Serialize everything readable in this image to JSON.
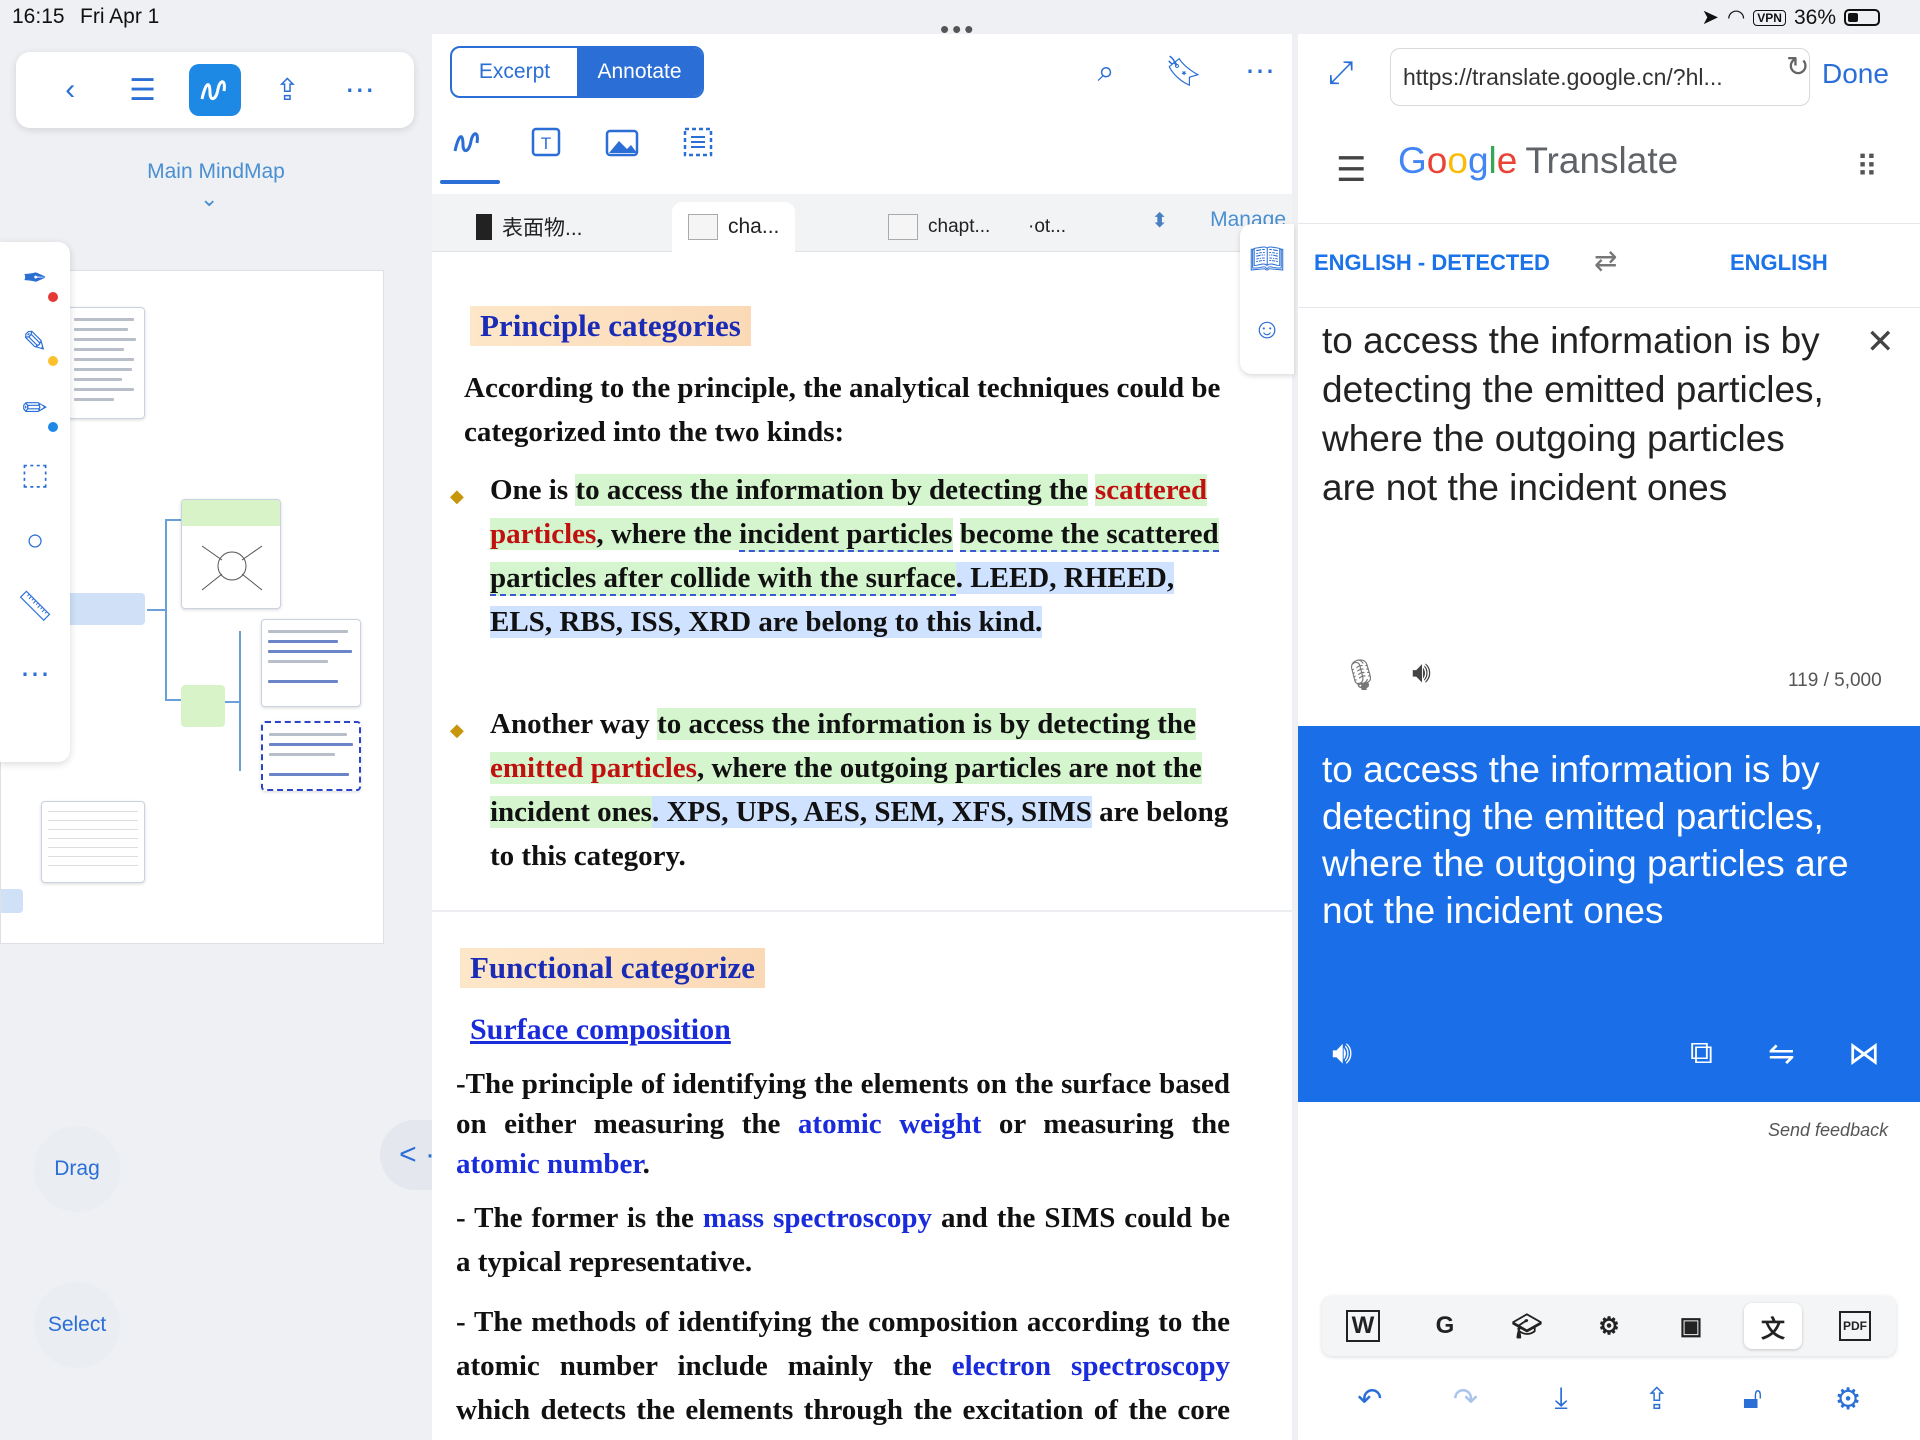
{
  "status": {
    "time": "16:15",
    "date": "Fri Apr 1",
    "vpn": "VPN",
    "battery": "36%",
    "grabber": "•••"
  },
  "left": {
    "mindmap_title": "Main MindMap",
    "drag_label": "Drag",
    "select_label": "Select",
    "nav_pill": "< · >"
  },
  "doc": {
    "seg_excerpt": "Excerpt",
    "seg_annotate": "Annotate",
    "tabs": [
      {
        "label": "表面物..."
      },
      {
        "label": "cha..."
      },
      {
        "label": "chapt..."
      },
      {
        "label": "·ot..."
      }
    ],
    "manage": "Manage",
    "sec1_title": "Principle categories",
    "intro": "According to the principle, the analytical techniques could be categorized into the two kinds:",
    "b1": {
      "a": "One is ",
      "b": "to access the information by detecting the",
      "c": "scattered particles",
      "d": ", where the ",
      "e": "incident particles",
      "f": "become the scattered particles after collide with the surface",
      "g": ". LEED, RHEED, ELS, RBS, ISS, XRD are belong to this kind."
    },
    "b2": {
      "a": "Another way ",
      "b": "to access the information is by detecting the ",
      "c": "emitted particles",
      "d": ", where the outgoing particles are not the incident ones",
      "e": ". XPS, UPS, AES, SEM, XFS, SIMS",
      "f": " are belong to this category."
    },
    "sec2_title": "Functional categorize",
    "sub_title": "Surface composition",
    "para1_a": "-The principle of identifying the elements on the surface based on either measuring the ",
    "para1_b": "atomic weight",
    "para1_c": " or measuring the ",
    "para1_d": "atomic number",
    "para1_e": ".",
    "para2_a": "- The former is the ",
    "para2_b": "mass spectroscopy",
    "para2_c": " and the SIMS could be a typical representative.",
    "para3_a": "- The methods of identifying the composition according to the atomic number include mainly the ",
    "para3_b": "electron spectroscopy",
    "para3_c": " which detects the elements through the excitation of the core electron energy levels of atoms."
  },
  "translate": {
    "url": "https://translate.google.cn/?hl...",
    "done": "Done",
    "logo_g": [
      "G",
      "o",
      "o",
      "g",
      "l",
      "e"
    ],
    "logo_suffix": "Translate",
    "src_lang": "ENGLISH - DETECTED",
    "tgt_lang": "ENGLISH",
    "source_text": "to access the information is by detecting the emitted particles, where the outgoing particles are not the incident ones",
    "char_count": "119 / 5,000",
    "result_text": "to access the information is by detecting the emitted particles, where the outgoing particles are not the incident ones",
    "feedback": "Send feedback",
    "tools": [
      "W",
      "G",
      "scholar-icon",
      "translate-app-icon",
      "image-icon",
      "translate-icon",
      "PDF"
    ]
  },
  "colors": {
    "accent": "#2b6fd6",
    "translate_blue": "#1a6fe8",
    "highlight_green": "#d4f5cd",
    "highlight_blue": "#cfe2ff",
    "heading_blue": "#1a2bb5"
  }
}
